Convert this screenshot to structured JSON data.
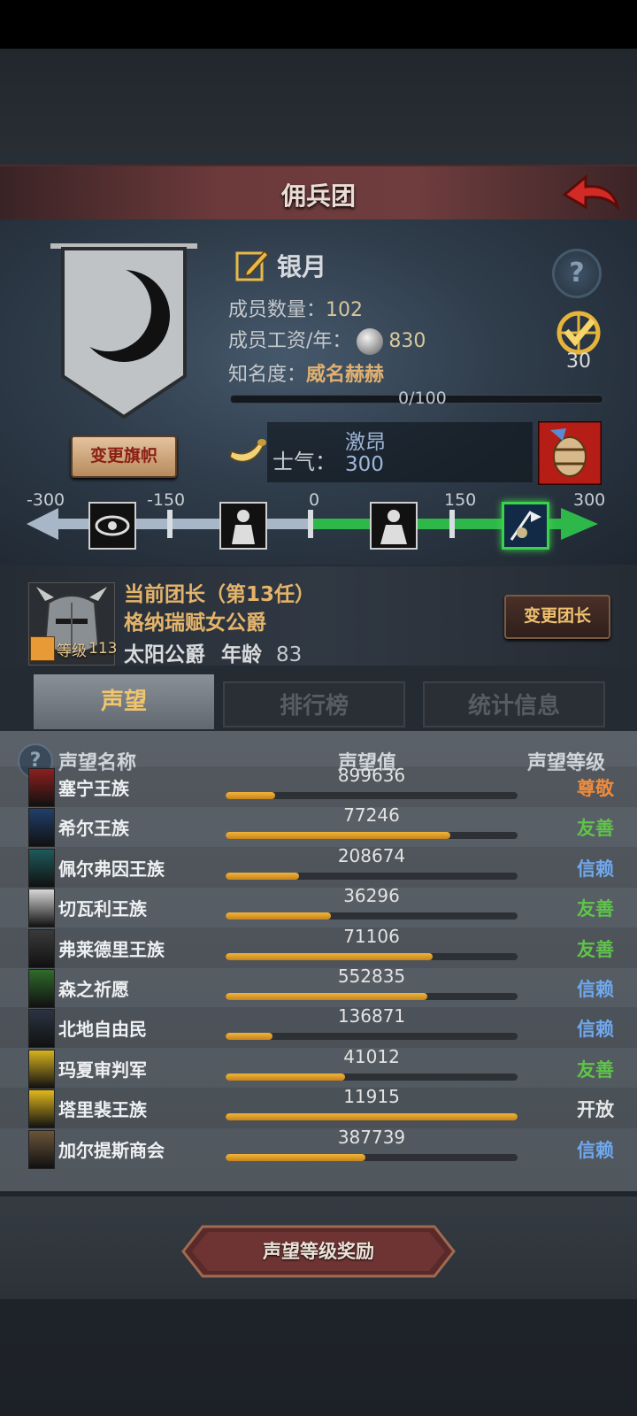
{
  "header": {
    "title": "佣兵团"
  },
  "guild": {
    "name": "银月",
    "members_label": "成员数量：",
    "members_value": "102",
    "salary_label": "成员工资/年：",
    "salary_value": "830",
    "fame_label": "知名度：",
    "fame_value": "威名赫赫",
    "fame_progress": "0/100",
    "fame_fraction": 0.0,
    "medal_value": "30",
    "change_flag_label": "变更旗帜"
  },
  "morale": {
    "label": "士气：",
    "status": "激昂",
    "value": "300",
    "scale": [
      "-300",
      "-150",
      "0",
      "150",
      "300"
    ]
  },
  "leader": {
    "line1": "当前团长（第13任）",
    "line2": "格纳瑞赋女公爵",
    "title": "太阳公爵",
    "age_label": "年龄",
    "age": "83",
    "level_label": "等级",
    "level": "113",
    "change_leader_label": "变更团长"
  },
  "tabs": [
    {
      "label": "声望",
      "active": true
    },
    {
      "label": "排行榜",
      "active": false
    },
    {
      "label": "统计信息",
      "active": false
    }
  ],
  "table": {
    "headers": {
      "name": "声望名称",
      "value": "声望值",
      "rank": "声望等级"
    },
    "rows": [
      {
        "name": "塞宁王族",
        "value": "899636",
        "rank": "尊敬",
        "progress": 0.17,
        "rank_color": "#f08a3a",
        "icon_color": "#8c1f1f"
      },
      {
        "name": "希尔王族",
        "value": "77246",
        "rank": "友善",
        "progress": 0.77,
        "rank_color": "#5fc34a",
        "icon_color": "#1f3f6a"
      },
      {
        "name": "佩尔弗因王族",
        "value": "208674",
        "rank": "信赖",
        "progress": 0.25,
        "rank_color": "#6fa8ee",
        "icon_color": "#1e5a5a"
      },
      {
        "name": "切瓦利王族",
        "value": "36296",
        "rank": "友善",
        "progress": 0.36,
        "rank_color": "#5fc34a",
        "icon_color": "#d8d8d8"
      },
      {
        "name": "弗莱德里王族",
        "value": "71106",
        "rank": "友善",
        "progress": 0.71,
        "rank_color": "#5fc34a",
        "icon_color": "#3a3a3a"
      },
      {
        "name": "森之祈愿",
        "value": "552835",
        "rank": "信赖",
        "progress": 0.69,
        "rank_color": "#6fa8ee",
        "icon_color": "#2f6a2a"
      },
      {
        "name": "北地自由民",
        "value": "136871",
        "rank": "信赖",
        "progress": 0.16,
        "rank_color": "#6fa8ee",
        "icon_color": "#2a3442"
      },
      {
        "name": "玛夏审判军",
        "value": "41012",
        "rank": "友善",
        "progress": 0.41,
        "rank_color": "#5fc34a",
        "icon_color": "#d8b21e"
      },
      {
        "name": "塔里裴王族",
        "value": "11915",
        "rank": "开放",
        "progress": 1.0,
        "rank_color": "#e6e6e6",
        "icon_color": "#e0b81c"
      },
      {
        "name": "加尔提斯商会",
        "value": "387739",
        "rank": "信赖",
        "progress": 0.48,
        "rank_color": "#6fa8ee",
        "icon_color": "#6a5438"
      }
    ]
  },
  "footer": {
    "reward_label": "声望等级奖励"
  },
  "icons": {
    "back": "back-arrow-icon",
    "help": "question-icon",
    "edit": "pen-icon",
    "coin": "silver-coin-icon",
    "medal": "medal-icon",
    "horn": "horn-icon",
    "barrel": "barrel-icon"
  }
}
